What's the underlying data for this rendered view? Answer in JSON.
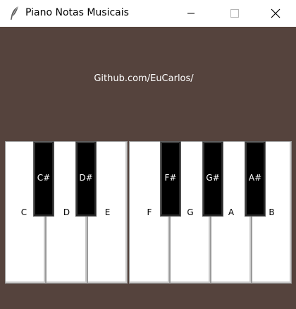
{
  "window": {
    "title": "Piano Notas Musicais",
    "icon": "feather-icon"
  },
  "controls": {
    "minimize": "minimize-icon",
    "maximize": "maximize-icon",
    "close": "close-icon"
  },
  "content": {
    "github_label": "Github.com/EuCarlos/"
  },
  "keys": {
    "white": [
      "C",
      "D",
      "E",
      "F",
      "G",
      "A",
      "B"
    ],
    "black": [
      "C#",
      "D#",
      "F#",
      "G#",
      "A#"
    ]
  },
  "colors": {
    "background": "#55433d",
    "white_key": "#ffffff",
    "black_key": "#000000"
  }
}
